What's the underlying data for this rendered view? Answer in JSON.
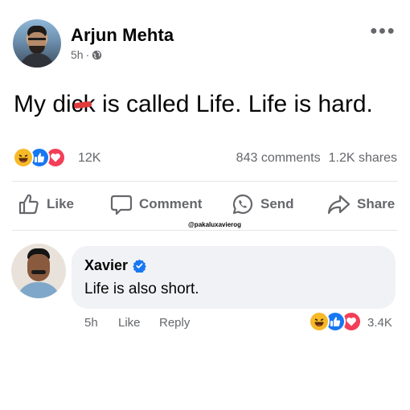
{
  "post": {
    "author": "Arjun Mehta",
    "time": "5h",
    "separator": "·",
    "text_before": "My d",
    "text_censored": "ick",
    "text_after": " is called Life. Life is hard.",
    "reaction_count": "12K",
    "comments_count": "843 comments",
    "shares_count": "1.2K shares"
  },
  "actions": {
    "like": "Like",
    "comment": "Comment",
    "send": "Send",
    "share": "Share"
  },
  "watermark": "@pakaluxavierog",
  "comment": {
    "author": "Xavier",
    "text": "Life is also short.",
    "time": "5h",
    "like": "Like",
    "reply": "Reply",
    "reaction_count": "3.4K"
  },
  "icons": {
    "privacy": "globe-icon",
    "more": "more-options-icon",
    "reactions": [
      "haha-icon",
      "like-icon",
      "love-icon"
    ],
    "verified": "verified-badge-icon"
  },
  "colors": {
    "like_blue": "#1877f2",
    "love_red": "#f33e58",
    "haha_yellow": "#f7b928",
    "censor_red": "#e23b3b",
    "muted_text": "#65676b",
    "bubble_bg": "#f0f2f5"
  }
}
